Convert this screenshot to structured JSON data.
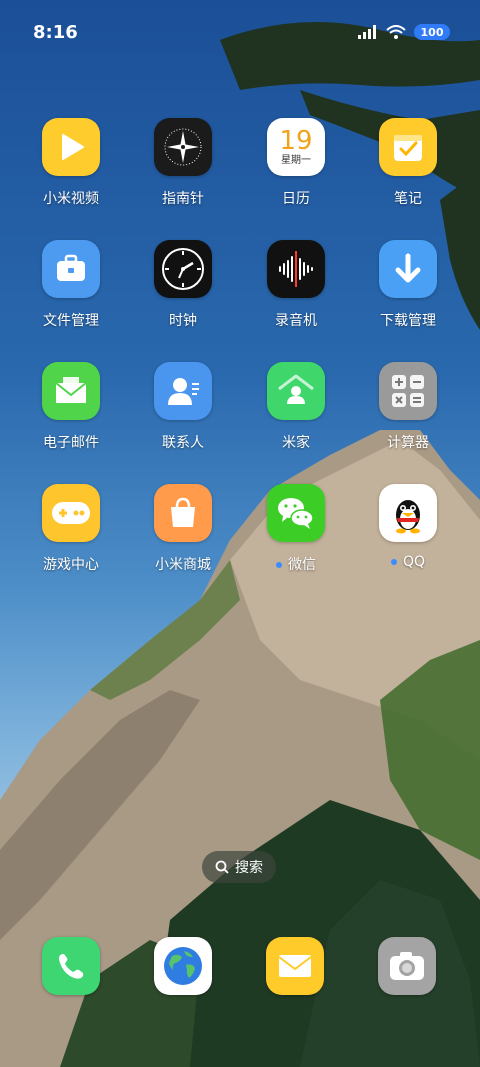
{
  "status_bar": {
    "time": "8:16",
    "battery": "100"
  },
  "apps": [
    {
      "label": "小米视频",
      "icon": "play-icon"
    },
    {
      "label": "指南针",
      "icon": "compass-icon"
    },
    {
      "label": "日历",
      "icon": "calendar-icon",
      "day": "19",
      "weekday": "星期一"
    },
    {
      "label": "笔记",
      "icon": "notes-icon"
    },
    {
      "label": "文件管理",
      "icon": "briefcase-icon"
    },
    {
      "label": "时钟",
      "icon": "clock-icon"
    },
    {
      "label": "录音机",
      "icon": "waveform-icon"
    },
    {
      "label": "下载管理",
      "icon": "download-arrow-icon"
    },
    {
      "label": "电子邮件",
      "icon": "envelope-icon"
    },
    {
      "label": "联系人",
      "icon": "contact-icon"
    },
    {
      "label": "米家",
      "icon": "home-icon"
    },
    {
      "label": "计算器",
      "icon": "calculator-icon"
    },
    {
      "label": "游戏中心",
      "icon": "gamepad-icon"
    },
    {
      "label": "小米商城",
      "icon": "shopping-bag-icon"
    },
    {
      "label": "微信",
      "icon": "wechat-icon"
    },
    {
      "label": "QQ",
      "icon": "qq-penguin-icon"
    }
  ],
  "search": {
    "label": "搜索"
  },
  "dock": [
    {
      "icon": "phone-icon"
    },
    {
      "icon": "browser-globe-icon"
    },
    {
      "icon": "messages-icon"
    },
    {
      "icon": "camera-icon"
    }
  ]
}
